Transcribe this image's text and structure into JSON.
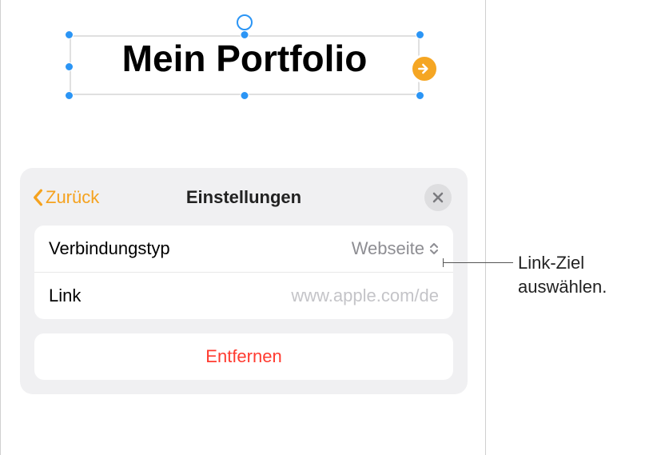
{
  "textbox": {
    "content": "Mein Portfolio"
  },
  "popover": {
    "back_label": "Zurück",
    "title": "Einstellungen",
    "rows": {
      "connection_type": {
        "label": "Verbindungstyp",
        "value": "Webseite"
      },
      "link": {
        "label": "Link",
        "value": "www.apple.com/de"
      }
    },
    "remove_label": "Entfernen"
  },
  "callout": {
    "line1": "Link-Ziel",
    "line2": "auswählen."
  },
  "colors": {
    "accent": "#f5a21e",
    "selection": "#2b95f5",
    "danger": "#ff3b30"
  }
}
